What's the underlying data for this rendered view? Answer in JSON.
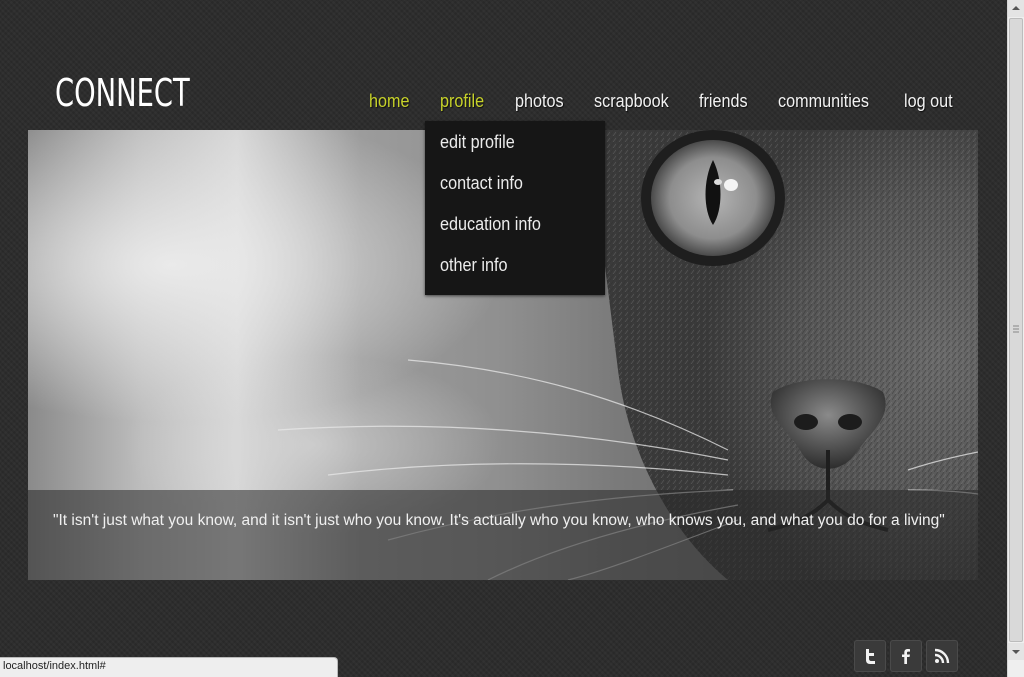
{
  "site": {
    "logo": "CONNECT"
  },
  "nav": {
    "items": [
      {
        "label": "home",
        "active": true
      },
      {
        "label": "profile",
        "active": true
      },
      {
        "label": "photos",
        "active": false
      },
      {
        "label": "scrapbook",
        "active": false
      },
      {
        "label": "friends",
        "active": false
      },
      {
        "label": "communities",
        "active": false
      },
      {
        "label": "log out",
        "active": false
      }
    ],
    "active_color": "#c7d22a"
  },
  "profile_menu": {
    "items": [
      "edit profile",
      "contact info",
      "education info",
      "other info"
    ]
  },
  "hero": {
    "image": "cat-face-photo",
    "quote": "\"It isn't just what you know, and it isn't just who you know. It's actually who you know, who knows you, and what you do for a living\""
  },
  "social": {
    "icons": [
      "twitter-icon",
      "facebook-icon",
      "rss-icon"
    ]
  },
  "browser": {
    "status_url": "localhost/index.html#"
  }
}
